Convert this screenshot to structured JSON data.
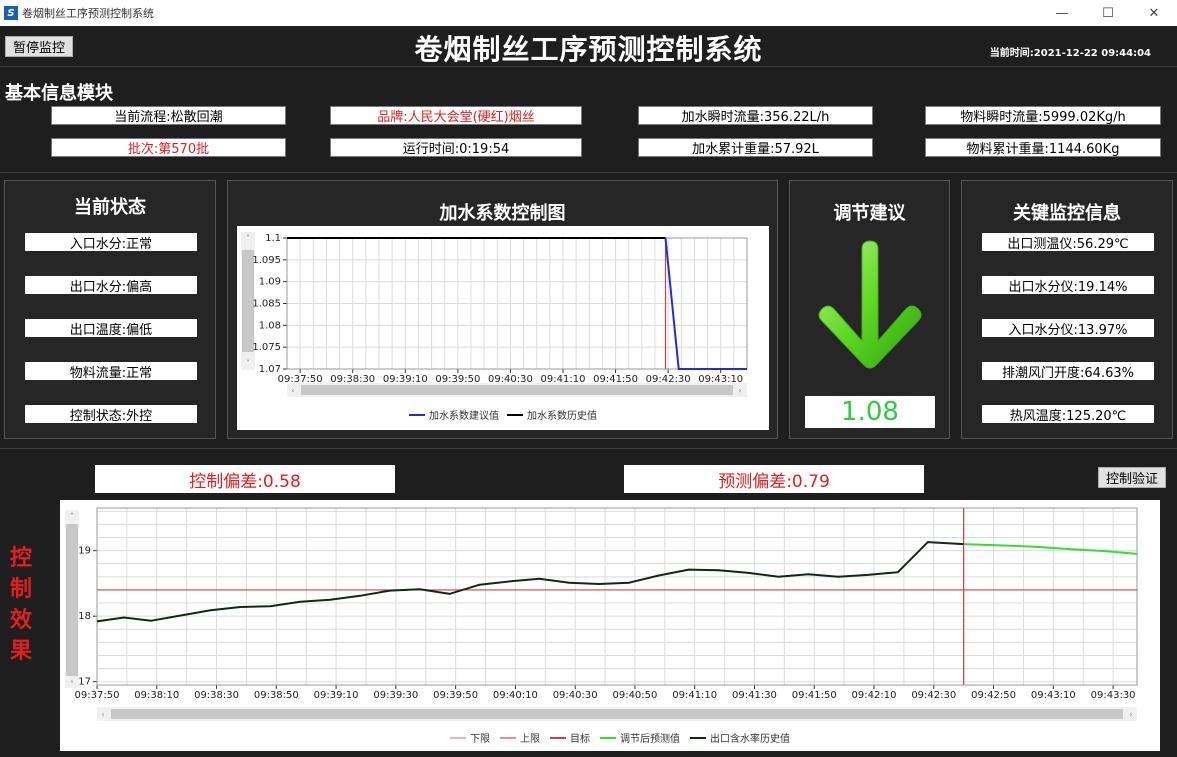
{
  "window": {
    "title": "卷烟制丝工序预测控制系统",
    "app_icon": "S"
  },
  "header": {
    "pause_label": "暂停监控",
    "title": "卷烟制丝工序预测控制系统",
    "clock": "当前时间:2021-12-22 09:44:04"
  },
  "basic": {
    "title": "基本信息模块",
    "flow": "当前流程:松散回潮",
    "brand": "品牌:人民大会堂(硬红)烟丝",
    "water_rate": "加水瞬时流量:356.22L/h",
    "material_rate": "物料瞬时流量:5999.02Kg/h",
    "batch": "批次:第570批",
    "runtime": "运行时间:0:19:54",
    "water_total": "加水累计重量:57.92L",
    "material_total": "物料累计重量:1144.60Kg"
  },
  "status": {
    "title": "当前状态",
    "items": [
      "入口水分:正常",
      "出口水分:偏高",
      "出口温度:偏低",
      "物料流量:正常",
      "控制状态:外控"
    ]
  },
  "coef_chart": {
    "title": "加水系数控制图",
    "legend": [
      "加水系数建议值",
      "加水系数历史值"
    ]
  },
  "advice": {
    "title": "调节建议",
    "direction": "down-arrow-icon",
    "value": "1.08"
  },
  "monitor": {
    "title": "关键监控信息",
    "items": [
      "出口测温仪:56.29℃",
      "出口水分仪:19.14%",
      "入口水分仪:13.97%",
      "排潮风门开度:64.63%",
      "热风温度:125.20℃"
    ]
  },
  "bottom": {
    "control_dev": "控制偏差:0.58",
    "predict_dev": "预测偏差:0.79",
    "verify_label": "控制验证",
    "side_label": [
      "控",
      "制",
      "效",
      "果"
    ]
  },
  "chart_data": [
    {
      "type": "line",
      "title": "加水系数控制图",
      "x_ticks": [
        "09:37:50",
        "09:38:30",
        "09:39:10",
        "09:39:50",
        "09:40:30",
        "09:41:10",
        "09:41:50",
        "09:42:30",
        "09:43:10"
      ],
      "y_ticks": [
        "1.07",
        "1.075",
        "1.08",
        "1.085",
        "1.09",
        "1.095",
        "1.1"
      ],
      "ylim": [
        1.07,
        1.1
      ],
      "xlim": [
        "09:37:40",
        "09:43:30"
      ],
      "marker_time": "09:42:28",
      "series": [
        {
          "name": "加水系数历史值",
          "color": "#000000",
          "points": [
            [
              "09:37:40",
              1.1
            ],
            [
              "09:42:28",
              1.1
            ]
          ]
        },
        {
          "name": "加水系数建议值",
          "color": "#1f2fd0",
          "points": [
            [
              "09:42:28",
              1.1
            ],
            [
              "09:42:38",
              1.07
            ],
            [
              "09:43:30",
              1.07
            ]
          ]
        }
      ]
    },
    {
      "type": "line",
      "title": "",
      "x_ticks": [
        "09:37:50",
        "09:38:10",
        "09:38:30",
        "09:38:50",
        "09:39:10",
        "09:39:30",
        "09:39:50",
        "09:40:10",
        "09:40:30",
        "09:40:50",
        "09:41:10",
        "09:41:30",
        "09:41:50",
        "09:42:10",
        "09:42:30",
        "09:42:50",
        "09:43:10",
        "09:43:30"
      ],
      "y_ticks": [
        "17",
        "18",
        "19"
      ],
      "ylim": [
        16.95,
        19.65
      ],
      "xlim": [
        "09:37:50",
        "09:43:38"
      ],
      "marker_time": "09:42:40",
      "reference_line": {
        "name": "目标",
        "value": 18.4,
        "color": "#d04040"
      },
      "legend": [
        {
          "name": "下限",
          "color": "#f0b0b0"
        },
        {
          "name": "上限",
          "color": "#e89090"
        },
        {
          "name": "目标",
          "color": "#d04040"
        },
        {
          "name": "调节后预测值",
          "color": "#33dd33"
        },
        {
          "name": "出口含水率历史值",
          "color": "#0d2a14"
        }
      ],
      "series": [
        {
          "name": "出口含水率历史值",
          "color": "#0d2a14",
          "points": [
            [
              "09:37:50",
              17.92
            ],
            [
              "09:37:59",
              17.98
            ],
            [
              "09:38:08",
              17.93
            ],
            [
              "09:38:18",
              18.01
            ],
            [
              "09:38:28",
              18.09
            ],
            [
              "09:38:38",
              18.14
            ],
            [
              "09:38:48",
              18.15
            ],
            [
              "09:38:58",
              18.22
            ],
            [
              "09:39:08",
              18.25
            ],
            [
              "09:39:18",
              18.31
            ],
            [
              "09:39:28",
              18.39
            ],
            [
              "09:39:38",
              18.41
            ],
            [
              "09:39:48",
              18.34
            ],
            [
              "09:39:58",
              18.48
            ],
            [
              "09:40:08",
              18.53
            ],
            [
              "09:40:18",
              18.57
            ],
            [
              "09:40:28",
              18.51
            ],
            [
              "09:40:38",
              18.49
            ],
            [
              "09:40:48",
              18.51
            ],
            [
              "09:40:58",
              18.62
            ],
            [
              "09:41:08",
              18.71
            ],
            [
              "09:41:18",
              18.7
            ],
            [
              "09:41:28",
              18.66
            ],
            [
              "09:41:38",
              18.6
            ],
            [
              "09:41:48",
              18.64
            ],
            [
              "09:41:58",
              18.6
            ],
            [
              "09:42:08",
              18.63
            ],
            [
              "09:42:18",
              18.67
            ],
            [
              "09:42:28",
              19.13
            ],
            [
              "09:42:40",
              19.1
            ]
          ]
        },
        {
          "name": "调节后预测值",
          "color": "#33dd33",
          "points": [
            [
              "09:42:40",
              19.1
            ],
            [
              "09:42:52",
              19.08
            ],
            [
              "09:43:04",
              19.06
            ],
            [
              "09:43:16",
              19.02
            ],
            [
              "09:43:28",
              18.99
            ],
            [
              "09:43:38",
              18.95
            ]
          ]
        }
      ]
    }
  ]
}
